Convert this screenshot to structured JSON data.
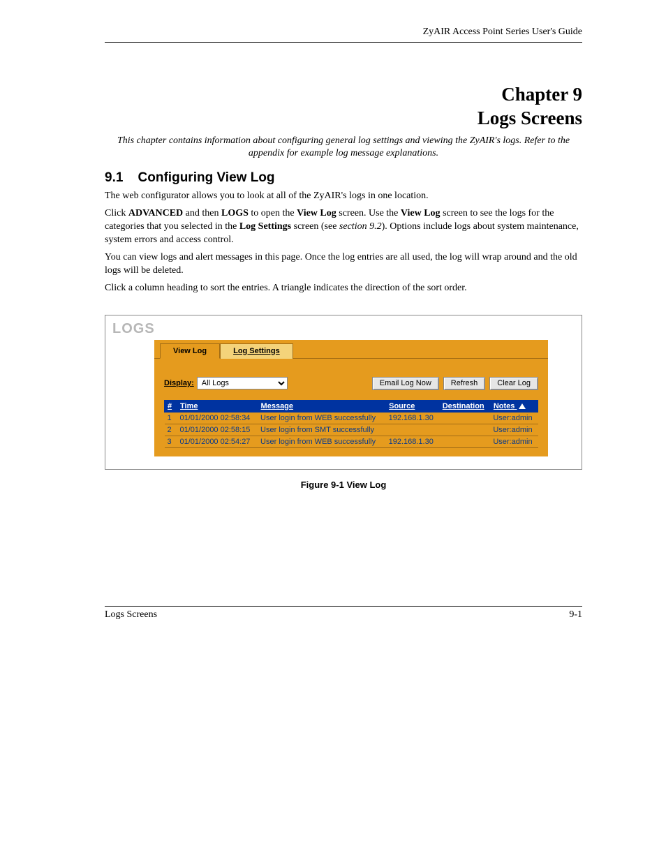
{
  "header": {
    "running": "ZyAIR Access Point Series User's Guide"
  },
  "chapter": {
    "line1": "Chapter 9",
    "line2": "Logs Screens",
    "intro": "This chapter contains information about configuring general log settings and viewing the ZyAIR's logs. Refer to the appendix for example log message explanations."
  },
  "section": {
    "number": "9.1",
    "title": "Configuring View Log",
    "p1": "The web configurator allows you to look at all of the ZyAIR's logs in one location.",
    "p2_a": "Click ",
    "p2_b": "ADVANCED",
    "p2_c": " and then ",
    "p2_d": "LOGS",
    "p2_e": " to open the ",
    "p2_f": "View Log",
    "p2_g": " screen. Use the ",
    "p2_h": "View Log",
    "p2_i": " screen to see the logs for the categories that you selected in the ",
    "p2_j": "Log Settings",
    "p2_k": " screen (see ",
    "p2_l": "section 9.2",
    "p2_m": "). Options include logs about system maintenance, system errors and access control.",
    "p3": "You can view logs and alert messages in this page. Once the log entries are all used, the log will wrap around and the old logs will be deleted.",
    "p4": "Click a column heading to sort the entries. A triangle indicates the direction of the sort order."
  },
  "screenshot": {
    "title": "LOGS",
    "tabs": {
      "active": "View Log",
      "inactive": "Log Settings"
    },
    "controls": {
      "display_label": "Display:",
      "display_value": "All Logs",
      "email_btn": "Email Log Now",
      "refresh_btn": "Refresh",
      "clear_btn": "Clear Log"
    },
    "columns": {
      "num": "#",
      "time": "Time",
      "message": "Message",
      "source": "Source",
      "destination": "Destination",
      "notes": "Notes"
    },
    "rows": [
      {
        "n": "1",
        "time": "01/01/2000 02:58:34",
        "message": "User login from WEB successfully",
        "source": "192.168.1.30",
        "dest": "",
        "notes": "User:admin"
      },
      {
        "n": "2",
        "time": "01/01/2000 02:58:15",
        "message": "User login from SMT successfully",
        "source": "",
        "dest": "",
        "notes": "User:admin"
      },
      {
        "n": "3",
        "time": "01/01/2000 02:54:27",
        "message": "User login from WEB successfully",
        "source": "192.168.1.30",
        "dest": "",
        "notes": "User:admin"
      }
    ]
  },
  "figure_caption": "Figure 9-1 View Log",
  "footer": {
    "left": "Logs Screens",
    "right": "9-1"
  }
}
